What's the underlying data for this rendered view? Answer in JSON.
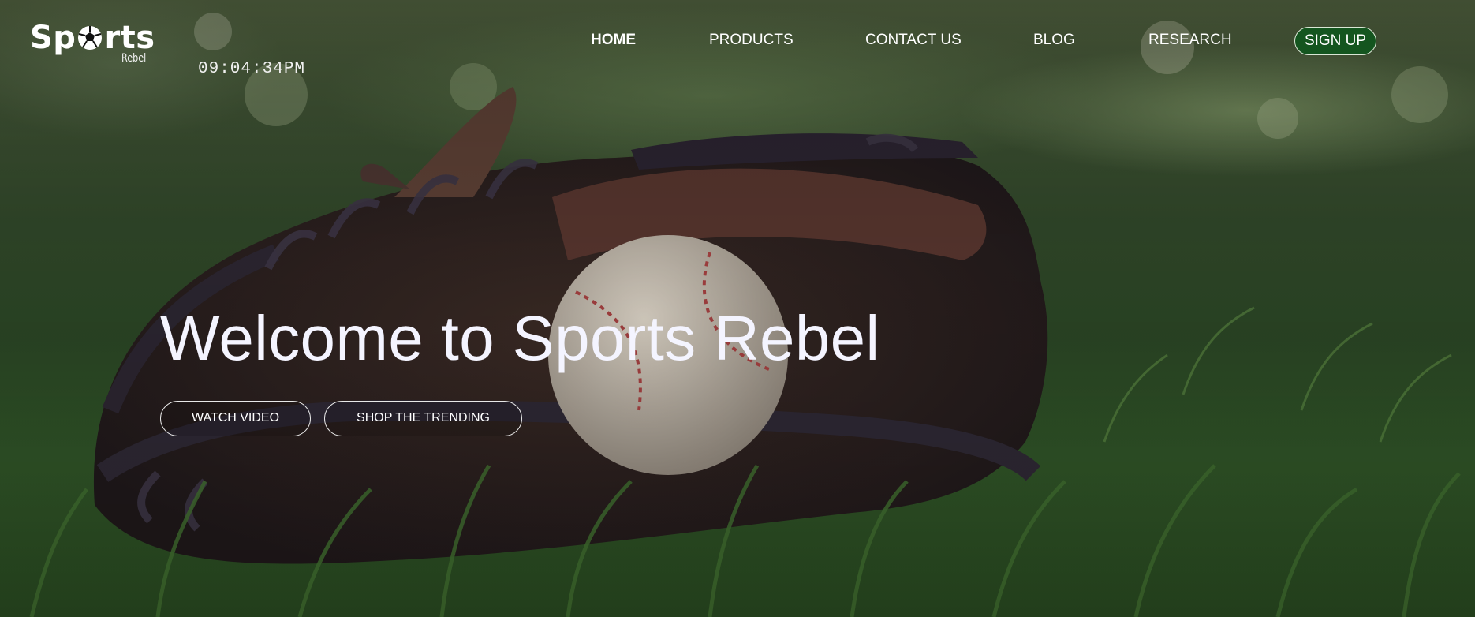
{
  "brand": {
    "logo_word_a": "Sp",
    "logo_word_b": "rts",
    "logo_sub": "Rebel",
    "logo_ball_icon": "soccer-ball-icon"
  },
  "clock": {
    "time": "09:04:34PM"
  },
  "nav": {
    "items": [
      {
        "label": "HOME",
        "active": true
      },
      {
        "label": "PRODUCTS",
        "active": false
      },
      {
        "label": "CONTACT US",
        "active": false
      },
      {
        "label": "BLOG",
        "active": false
      },
      {
        "label": "RESEARCH",
        "active": false
      }
    ],
    "signup_label": "SIGN UP"
  },
  "hero": {
    "headline": "Welcome to Sports Rebel",
    "buttons": {
      "watch_video": "WATCH VIDEO",
      "shop_trending": "SHOP THE TRENDING"
    }
  },
  "colors": {
    "accent_green": "#14551f",
    "text": "#ffffff"
  }
}
